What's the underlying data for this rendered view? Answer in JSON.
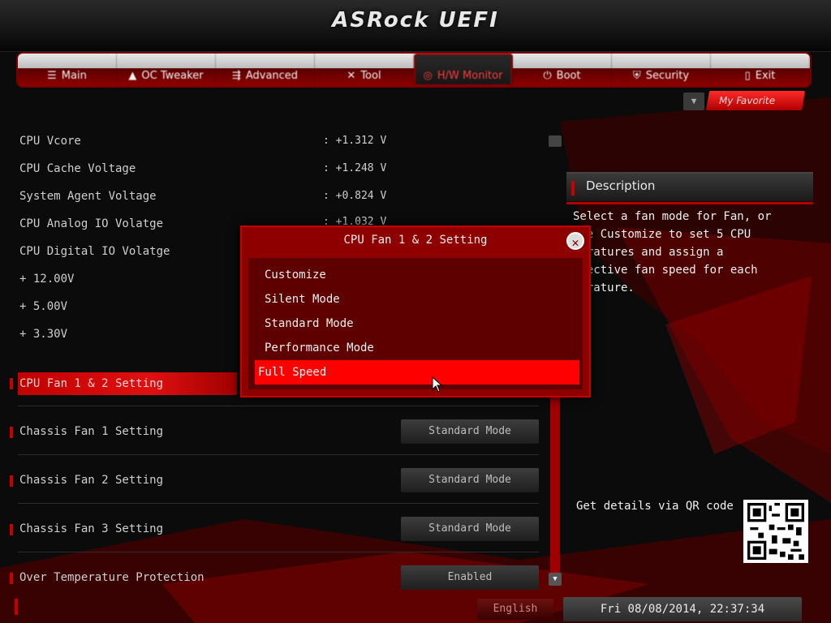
{
  "header": {
    "logo": "ASRock UEFI"
  },
  "tabs": [
    {
      "label": "Main",
      "icon": "list-icon"
    },
    {
      "label": "OC Tweaker",
      "icon": "rocket-icon"
    },
    {
      "label": "Advanced",
      "icon": "arrows-icon"
    },
    {
      "label": "Tool",
      "icon": "tools-icon"
    },
    {
      "label": "H/W Monitor",
      "icon": "monitor-icon",
      "active": true
    },
    {
      "label": "Boot",
      "icon": "power-icon"
    },
    {
      "label": "Security",
      "icon": "shield-icon"
    },
    {
      "label": "Exit",
      "icon": "door-icon"
    }
  ],
  "favorite": {
    "label": "My Favorite"
  },
  "voltages": [
    {
      "label": "CPU Vcore",
      "value": ": +1.312 V"
    },
    {
      "label": "CPU Cache Voltage",
      "value": ": +1.248 V"
    },
    {
      "label": "System Agent Voltage",
      "value": ": +0.824 V"
    },
    {
      "label": "CPU Analog IO Volatge",
      "value": ": +1.032 V"
    },
    {
      "label": "CPU Digital IO Volatge",
      "value": ""
    },
    {
      "label": "+ 12.00V",
      "value": ""
    },
    {
      "label": "+ 5.00V",
      "value": ""
    },
    {
      "label": "+ 3.30V",
      "value": ""
    }
  ],
  "fan_settings": [
    {
      "label": "CPU Fan 1 & 2 Setting",
      "value": ""
    },
    {
      "label": "Chassis Fan 1 Setting",
      "value": "Standard Mode"
    },
    {
      "label": "Chassis Fan 2 Setting",
      "value": "Standard Mode"
    },
    {
      "label": "Chassis Fan 3 Setting",
      "value": "Standard Mode"
    },
    {
      "label": "Over Temperature Protection",
      "value": "Enabled"
    }
  ],
  "description": {
    "title": "Description",
    "text": "Select a fan mode for Fan, or\nose Customize to set 5 CPU\nperatures and assign a\nspective fan speed for each\nperature.",
    "qr_label": "Get details via QR code"
  },
  "popup": {
    "title": "CPU Fan 1 & 2 Setting",
    "options": [
      "Customize",
      "Silent Mode",
      "Standard Mode",
      "Performance Mode",
      "Full Speed"
    ],
    "selected": "Full Speed"
  },
  "footer": {
    "language": "English",
    "datetime": "Fri 08/08/2014, 22:37:34"
  },
  "colors": {
    "accent": "#ff0000",
    "dark_red": "#8e0000",
    "background": "#0b0b0b"
  }
}
